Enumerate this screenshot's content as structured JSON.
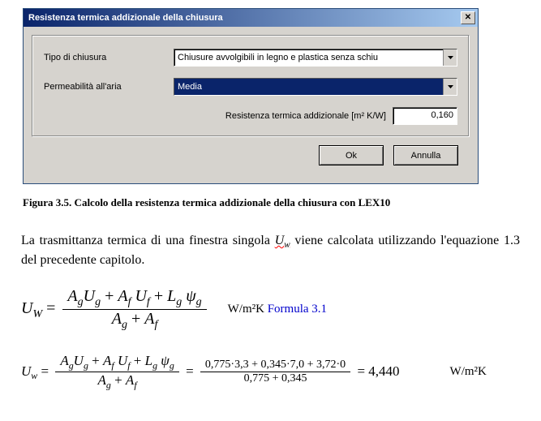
{
  "dialog": {
    "title": "Resistenza termica addizionale della chiusura",
    "field1_label": "Tipo di chiusura",
    "field1_value": "Chiusure avvolgibili in legno e plastica senza schiu",
    "field2_label": "Permeabilità all'aria",
    "field2_value": "Media",
    "res_label": "Resistenza termica addizionale [m² K/W]",
    "res_value": "0,160",
    "ok": "Ok",
    "cancel": "Annulla"
  },
  "caption": "Figura 3.5. Calcolo della resistenza termica addizionale della chiusura con LEX10",
  "prose_a": "La trasmittanza termica di una finestra singola ",
  "prose_uw": "U",
  "prose_uw_sub": "w",
  "prose_b": " viene calcolata utilizzando l'equazione 1.3 del precedente capitolo.",
  "eq1": {
    "lhs": "U",
    "lhs_sub": "W",
    "num": "AgUg + Af Uf + Lg ψg",
    "den": "Ag + Af",
    "unit": "W/m²K",
    "link": "Formula 3.1"
  },
  "eq2": {
    "lhs": "U",
    "lhs_sub": "w",
    "num": "AgUg + Af Uf + Lg ψg",
    "den": "Ag + Af",
    "num2": "0,775·3,3 + 0,345·7,0 + 3,72·0",
    "den2": "0,775 + 0,345",
    "result": "4,440",
    "unit": "W/m²K"
  }
}
